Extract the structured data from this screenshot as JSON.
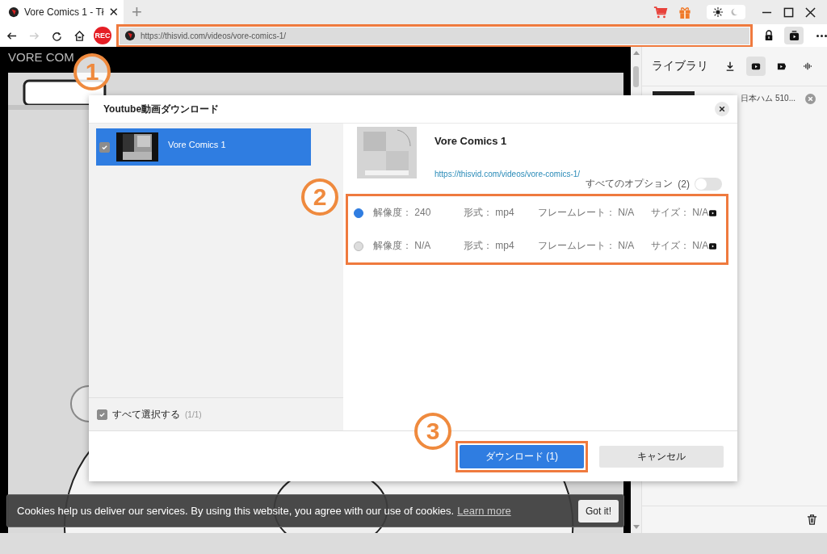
{
  "tab": {
    "title": "Vore Comics 1 - Tł",
    "close": "✕",
    "new_tab": "+"
  },
  "theme": {
    "dark": false
  },
  "toolbar": {
    "rec": "REC",
    "url": "https://thisvid.com/videos/vore-comics-1/"
  },
  "page": {
    "heading": "VORE COM",
    "kind": "picture"
  },
  "library": {
    "title": "ライブラリ",
    "tabs": [
      {
        "kind": "download",
        "selected": false
      },
      {
        "kind": "video",
        "selected": true
      },
      {
        "kind": "clip",
        "selected": false
      },
      {
        "kind": "audio",
        "selected": false
      }
    ],
    "items": [
      {
        "title": "日本ハム 510..."
      }
    ]
  },
  "dialog": {
    "title": "Youtube動画ダウンロード",
    "videos": [
      {
        "title": "Vore Comics 1",
        "checked": true,
        "selected": true
      }
    ],
    "select_all": {
      "label": "すべて選択する",
      "count": "(1/1)",
      "checked": true
    },
    "detail": {
      "title": "Vore Comics 1",
      "url": "https://thisvid.com/videos/vore-comics-1/",
      "all_options": "すべてのオプション",
      "options_count": "(2)",
      "all_options_on": false
    },
    "options": [
      {
        "selected": true,
        "resolution": "解像度： 240",
        "format": "形式： mp4",
        "frame_rate": "フレームレート： N/A",
        "size": "サイズ： N/A"
      },
      {
        "selected": false,
        "resolution": "解像度： N/A",
        "format": "形式： mp4",
        "frame_rate": "フレームレート： N/A",
        "size": "サイズ： N/A"
      }
    ],
    "download": "ダウンロード (1)",
    "cancel": "キャンセル"
  },
  "cookie": {
    "text": "Cookies help us deliver our services. By using this website, you agree with our use of cookies.",
    "link": "Learn more",
    "button": "Got it!"
  },
  "markers": [
    "1",
    "2",
    "3"
  ]
}
